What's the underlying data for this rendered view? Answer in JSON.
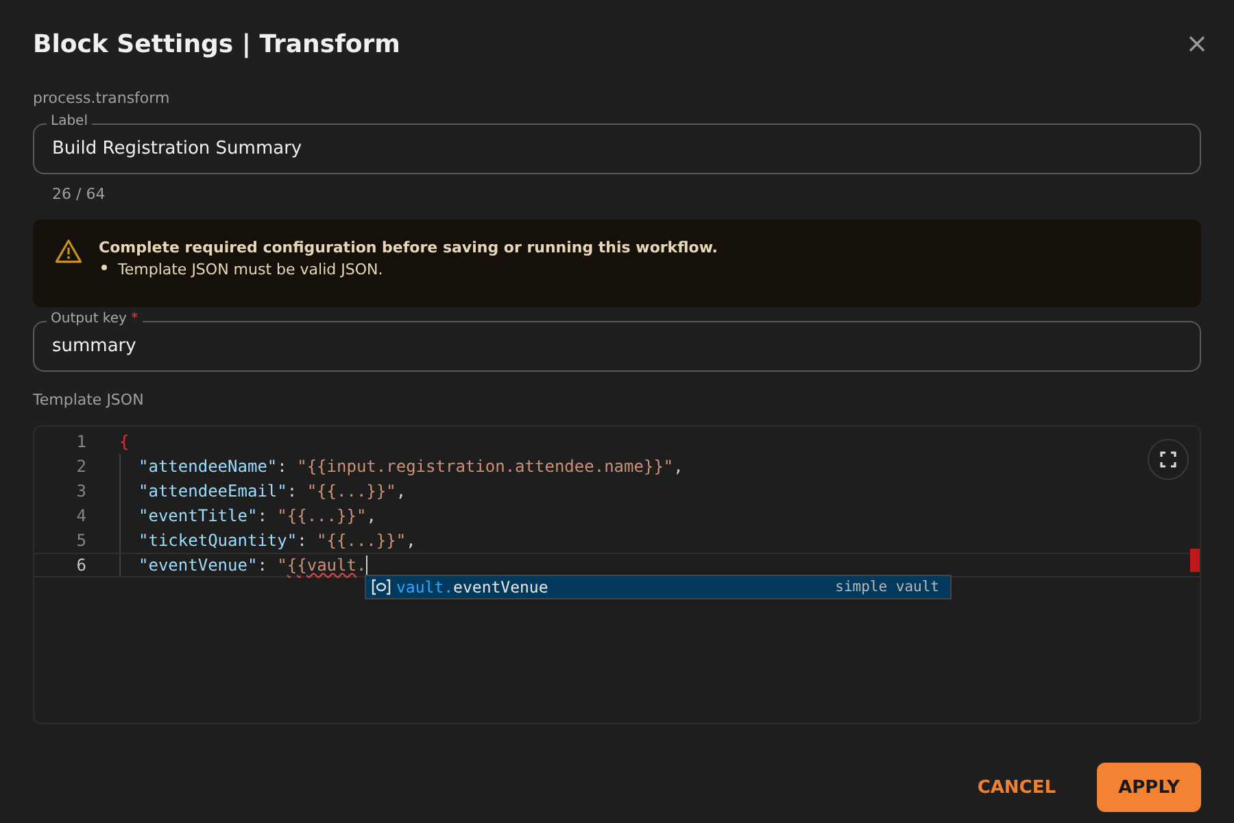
{
  "dialog": {
    "title": "Block Settings | Transform",
    "subtitle": "process.transform"
  },
  "label_field": {
    "label": "Label",
    "value": "Build Registration Summary",
    "counter": "26 / 64"
  },
  "alert": {
    "title": "Complete required configuration before saving or running this workflow.",
    "items": [
      "Template JSON must be valid JSON."
    ]
  },
  "output_key_field": {
    "label": "Output key",
    "required_mark": "*",
    "value": "summary"
  },
  "template": {
    "label": "Template JSON",
    "lines": [
      {
        "number": "1",
        "current": false,
        "segments": [
          {
            "kind": "brace",
            "text": "{"
          }
        ]
      },
      {
        "number": "2",
        "current": false,
        "segments": [
          {
            "kind": "key",
            "text": "\"attendeeName\""
          },
          {
            "kind": "punct",
            "text": ": "
          },
          {
            "kind": "string",
            "text": "\"{{input.registration.attendee.name}}\""
          },
          {
            "kind": "punct",
            "text": ","
          }
        ]
      },
      {
        "number": "3",
        "current": false,
        "segments": [
          {
            "kind": "key",
            "text": "\"attendeeEmail\""
          },
          {
            "kind": "punct",
            "text": ": "
          },
          {
            "kind": "string",
            "text": "\"{{...}}\""
          },
          {
            "kind": "punct",
            "text": ","
          }
        ]
      },
      {
        "number": "4",
        "current": false,
        "segments": [
          {
            "kind": "key",
            "text": "\"eventTitle\""
          },
          {
            "kind": "punct",
            "text": ": "
          },
          {
            "kind": "string",
            "text": "\"{{...}}\""
          },
          {
            "kind": "punct",
            "text": ","
          }
        ]
      },
      {
        "number": "5",
        "current": false,
        "segments": [
          {
            "kind": "key",
            "text": "\"ticketQuantity\""
          },
          {
            "kind": "punct",
            "text": ": "
          },
          {
            "kind": "string",
            "text": "\"{{...}}\""
          },
          {
            "kind": "punct",
            "text": ","
          }
        ]
      },
      {
        "number": "6",
        "current": true,
        "segments": [
          {
            "kind": "key",
            "text": "\"eventVenue\""
          },
          {
            "kind": "punct",
            "text": ": "
          },
          {
            "kind": "string",
            "text": "\""
          },
          {
            "kind": "error",
            "text": "{{vault"
          },
          {
            "kind": "string",
            "text": "."
          }
        ]
      }
    ],
    "suggestions": [
      {
        "match": "vault.",
        "rest": "eventVenue",
        "detail": "simple vault",
        "selected": true
      }
    ]
  },
  "buttons": [
    {
      "label": "CANCEL",
      "kind": "text"
    },
    {
      "label": "APPLY",
      "kind": "primary"
    }
  ]
}
